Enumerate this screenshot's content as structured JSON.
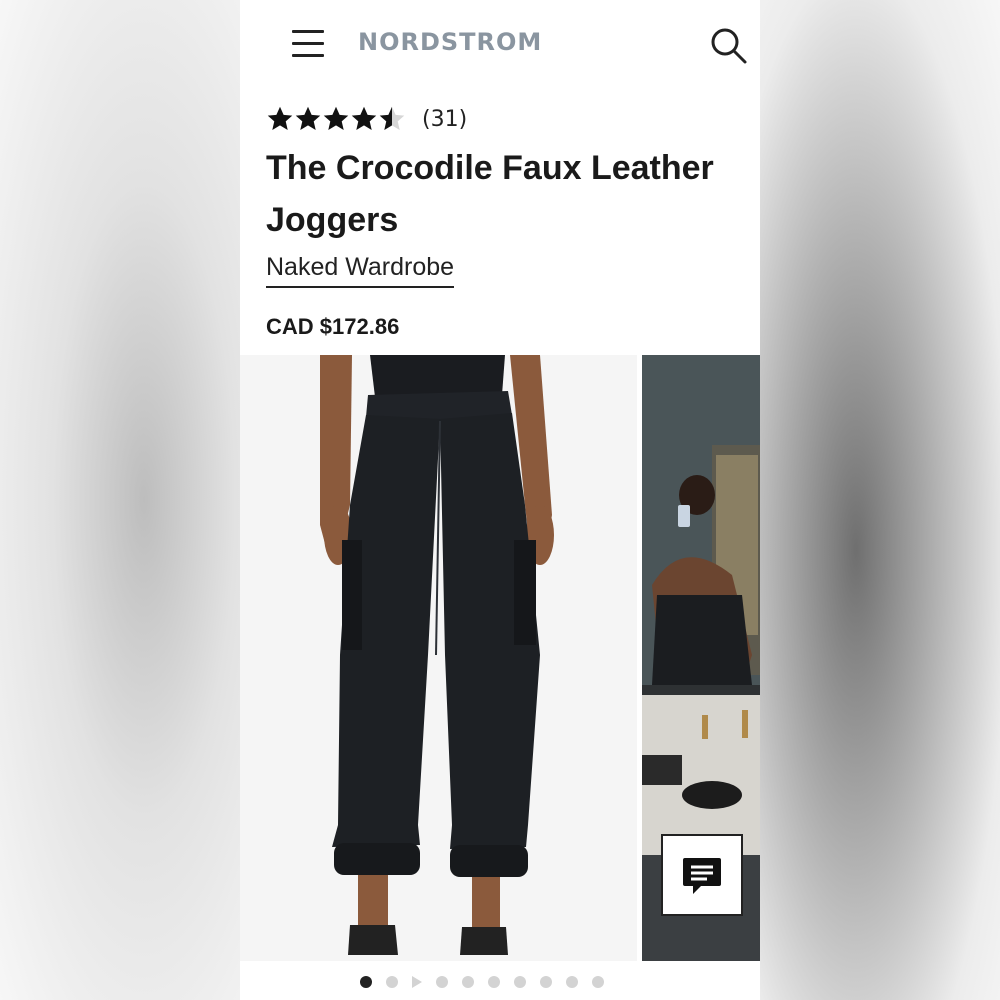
{
  "header": {
    "logo_text": "NORDSTROM",
    "menu_icon": "hamburger-menu-icon",
    "search_icon": "search-icon"
  },
  "product": {
    "rating": 4.5,
    "rating_max": 5,
    "review_count": "(31)",
    "title": "The Crocodile Faux Leather Joggers",
    "brand": "Naked Wardrobe",
    "price": "CAD $172.86"
  },
  "gallery": {
    "image_count": 10,
    "active_index": 0,
    "video_index": 2
  },
  "chat": {
    "icon": "chat-icon"
  },
  "colors": {
    "text": "#1a1a1a",
    "logo": "#8a95a0",
    "dot_inactive": "#d3d3d3",
    "dot_active": "#222222"
  }
}
